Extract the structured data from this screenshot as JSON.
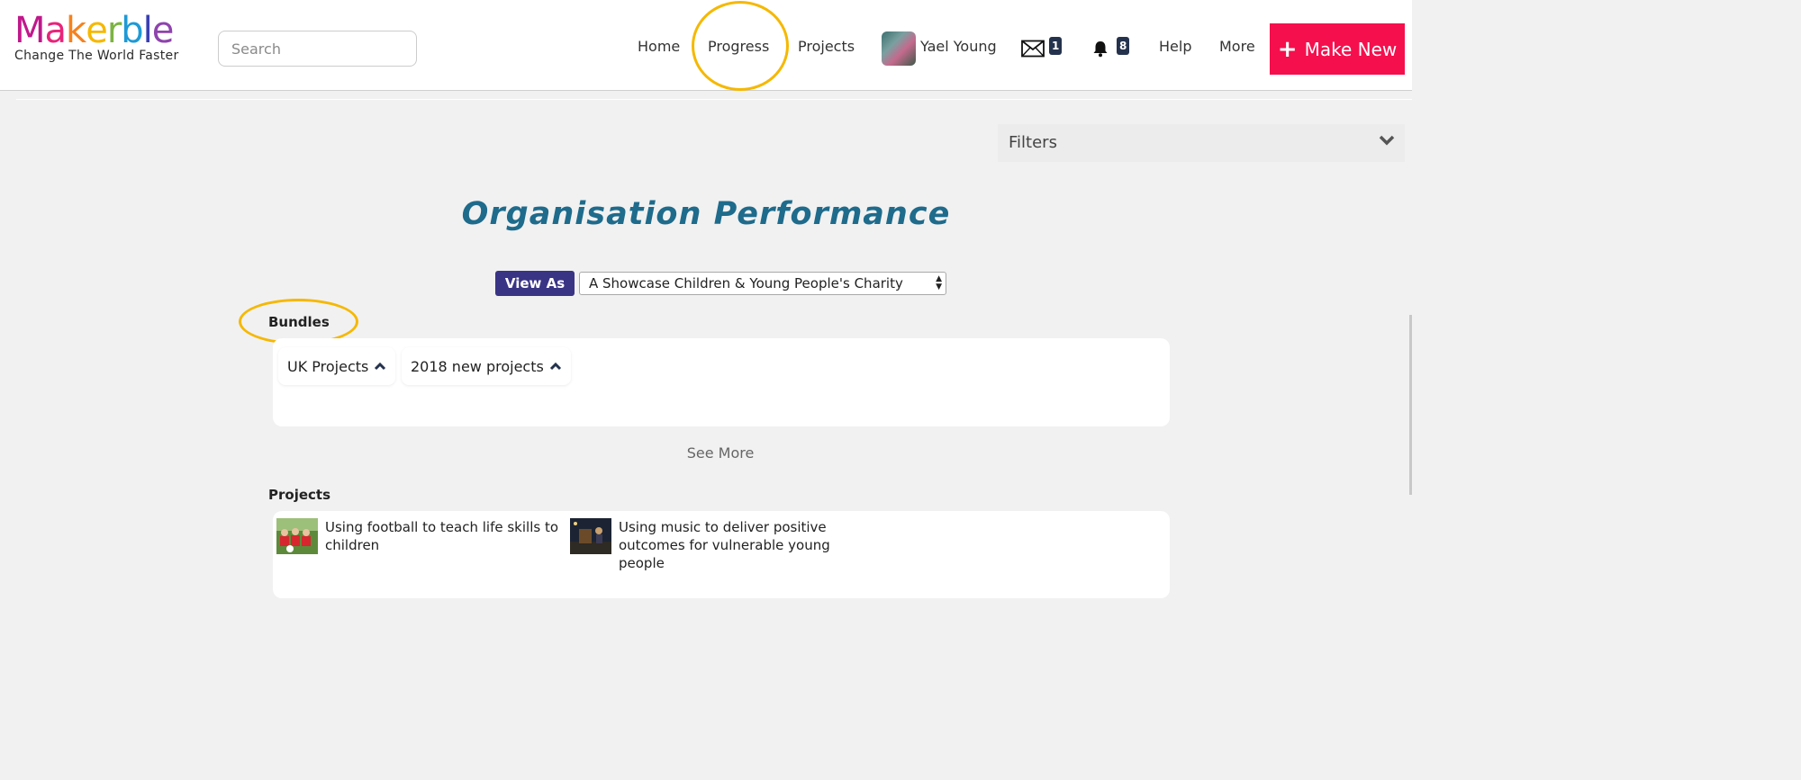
{
  "logo": {
    "letters": [
      "M",
      "a",
      "k",
      "e",
      "r",
      "b",
      "l",
      "e"
    ],
    "colors": [
      "#c0188b",
      "#e8247a",
      "#f5821f",
      "#f5b800",
      "#7cb342",
      "#1e9ad6",
      "#3a3fb2",
      "#8e44ad"
    ],
    "tagline": "Change The World Faster"
  },
  "search": {
    "placeholder": "Search"
  },
  "nav": {
    "home": "Home",
    "progress": "Progress",
    "projects": "Projects",
    "user_name": "Yael Young",
    "messages_count": "1",
    "notifications_count": "8",
    "help": "Help",
    "more": "More",
    "make_new": "Make New"
  },
  "filters": {
    "label": "Filters"
  },
  "main": {
    "title": "Organisation Performance",
    "view_as_label": "View As",
    "view_as_selected": "A Showcase Children & Young People's Charity",
    "bundles_heading": "Bundles",
    "bundles": [
      {
        "label": "UK Projects"
      },
      {
        "label": "2018 new projects"
      }
    ],
    "see_more": "See More",
    "projects_heading": "Projects",
    "projects": [
      {
        "title_line1": "Using football to teach life skills to",
        "title_line2": "children"
      },
      {
        "title_line1": "Using music to deliver positive",
        "title_line2": "outcomes for vulnerable young",
        "title_line3": "people"
      }
    ]
  },
  "colors": {
    "accent_red": "#f50f4d",
    "title_blue": "#1e6b8c",
    "view_as_purple": "#3a3485",
    "highlight_ring": "#f5b800",
    "badge_navy": "#24324d"
  }
}
